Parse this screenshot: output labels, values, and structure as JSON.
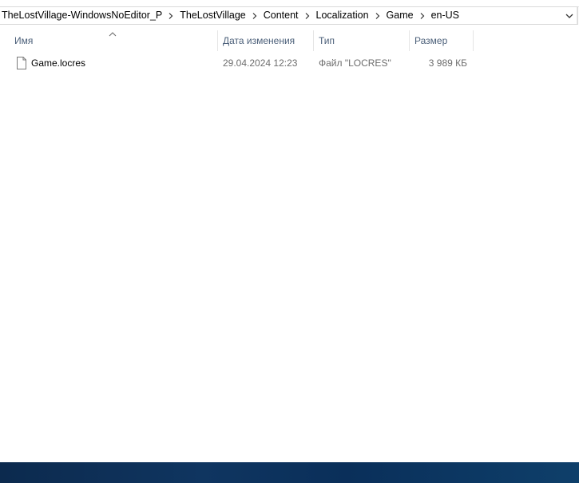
{
  "breadcrumb": {
    "items": [
      {
        "label": "TheLostVillage-WindowsNoEditor_P"
      },
      {
        "label": "TheLostVillage"
      },
      {
        "label": "Content"
      },
      {
        "label": "Localization"
      },
      {
        "label": "Game"
      },
      {
        "label": "en-US"
      }
    ]
  },
  "columns": {
    "name": "Имя",
    "date": "Дата изменения",
    "type": "Тип",
    "size": "Размер"
  },
  "files": [
    {
      "name": "Game.locres",
      "date": "29.04.2024 12:23",
      "type": "Файл \"LOCRES\"",
      "size": "3 989 КБ",
      "icon": "document-icon"
    }
  ],
  "colors": {
    "header_text": "#4c607a",
    "taskbar": "#0f3560"
  }
}
